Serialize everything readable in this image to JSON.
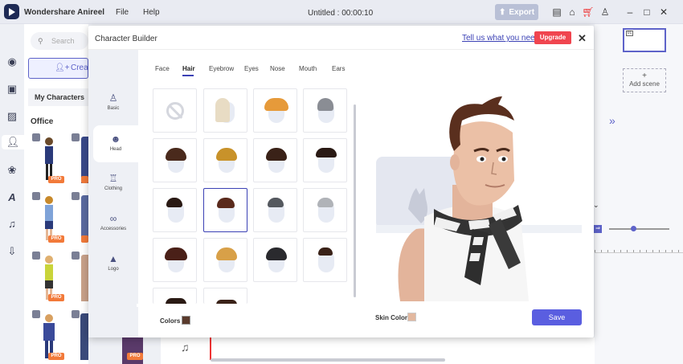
{
  "app": {
    "name": "Wondershare Anireel",
    "menu": [
      "File",
      "Help"
    ],
    "doc_title": "Untitled : 00:00:10",
    "export_label": "Export"
  },
  "char_panel": {
    "search_placeholder": "Search",
    "create_label": "Create",
    "my_characters_label": "My Characters",
    "category_label": "Office",
    "pro_badge": "PRO"
  },
  "right_panel": {
    "add_scene_label": "Add scene"
  },
  "modal": {
    "title": "Character Builder",
    "feedback_link": "Tell us what you need",
    "upgrade_label": "Upgrade",
    "side_menu": [
      {
        "label": "Basic",
        "icon": "person-icon"
      },
      {
        "label": "Head",
        "icon": "head-icon"
      },
      {
        "label": "Clothing",
        "icon": "shirt-icon"
      },
      {
        "label": "Accessories",
        "icon": "glasses-icon"
      },
      {
        "label": "Logo",
        "icon": "shapes-icon"
      }
    ],
    "tabs": [
      "Face",
      "Hair",
      "Eyebrow",
      "Eyes",
      "Nose",
      "Mouth",
      "Ears"
    ],
    "active_tab": "Hair",
    "colors_label": "Colors",
    "hair_color": "#5a3a2c",
    "skin_color_label": "Skin Color",
    "skin_color": "#e2b89f",
    "save_label": "Save",
    "accent": "#5a5ee0"
  }
}
